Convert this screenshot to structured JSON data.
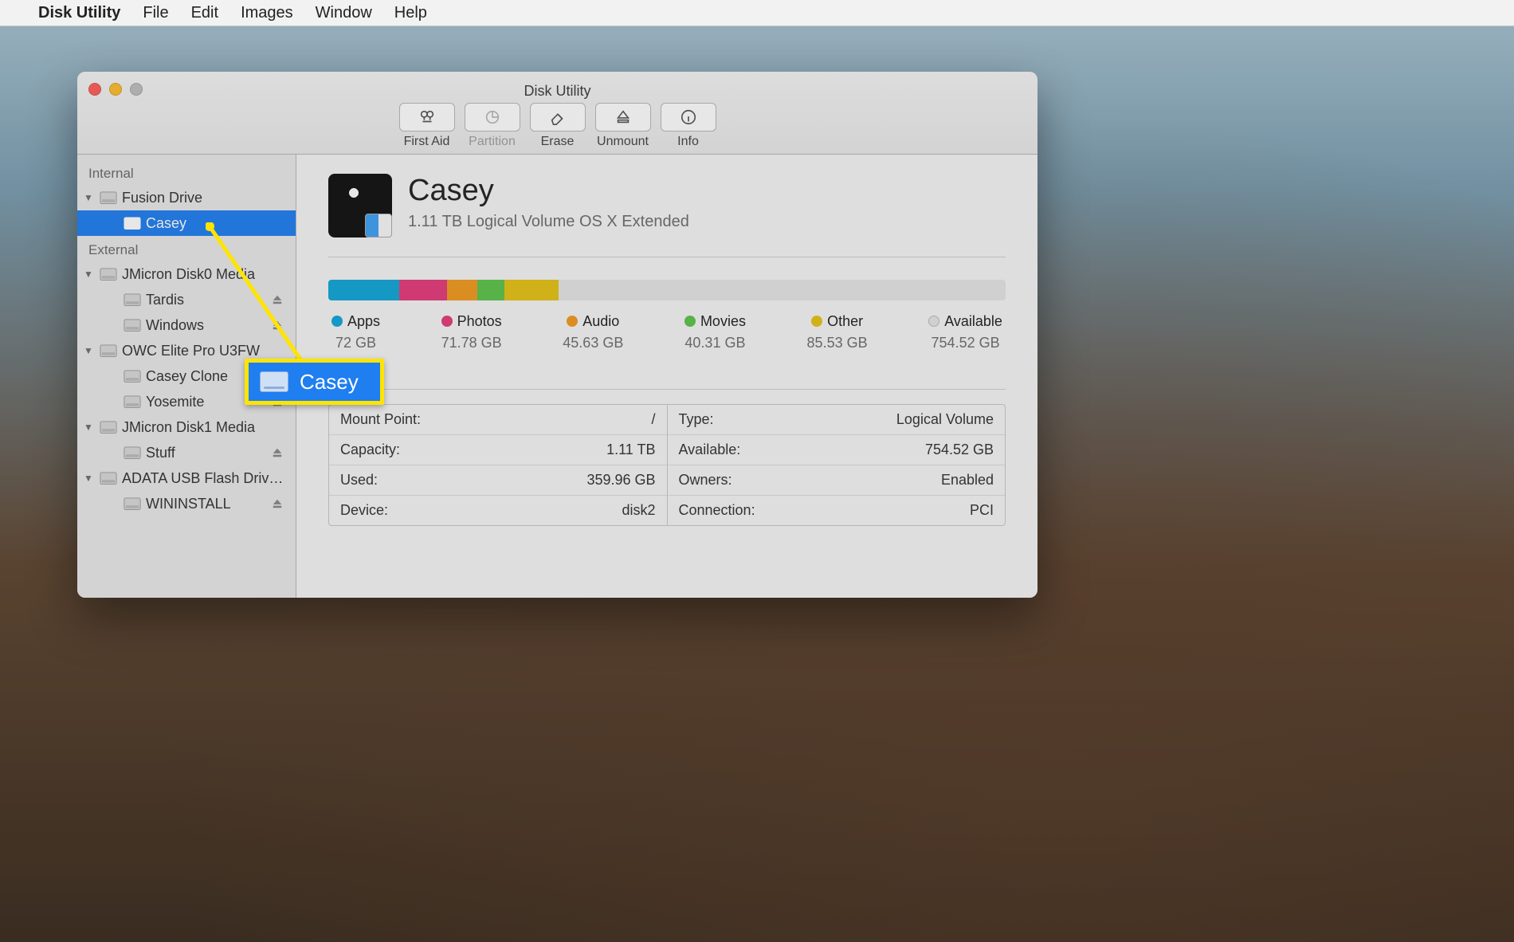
{
  "menubar": {
    "app": "Disk Utility",
    "items": [
      "File",
      "Edit",
      "Images",
      "Window",
      "Help"
    ]
  },
  "window": {
    "title": "Disk Utility",
    "toolbar": [
      {
        "id": "first-aid",
        "label": "First Aid",
        "enabled": true
      },
      {
        "id": "partition",
        "label": "Partition",
        "enabled": false
      },
      {
        "id": "erase",
        "label": "Erase",
        "enabled": true
      },
      {
        "id": "unmount",
        "label": "Unmount",
        "enabled": true
      },
      {
        "id": "info",
        "label": "Info",
        "enabled": true
      }
    ]
  },
  "sidebar": {
    "sections": [
      {
        "title": "Internal",
        "items": [
          {
            "name": "Fusion Drive",
            "level": 0,
            "disclosure": true,
            "eject": false
          },
          {
            "name": "Casey",
            "level": 1,
            "selected": true,
            "eject": false
          }
        ]
      },
      {
        "title": "External",
        "items": [
          {
            "name": "JMicron Disk0 Media",
            "level": 0,
            "disclosure": true,
            "eject": false
          },
          {
            "name": "Tardis",
            "level": 1,
            "eject": true
          },
          {
            "name": "Windows",
            "level": 1,
            "eject": true
          },
          {
            "name": "OWC Elite Pro U3FW",
            "level": 0,
            "disclosure": true,
            "eject": false
          },
          {
            "name": "Casey Clone",
            "level": 1,
            "eject": true
          },
          {
            "name": "Yosemite",
            "level": 1,
            "eject": true
          },
          {
            "name": "JMicron Disk1 Media",
            "level": 0,
            "disclosure": true,
            "eject": false
          },
          {
            "name": "Stuff",
            "level": 1,
            "eject": true
          },
          {
            "name": "ADATA USB Flash Driv…",
            "level": 0,
            "disclosure": true,
            "eject": false
          },
          {
            "name": "WININSTALL",
            "level": 1,
            "eject": true
          }
        ]
      }
    ]
  },
  "volume": {
    "name": "Casey",
    "subtitle": "1.11 TB Logical Volume OS X Extended",
    "usage": [
      {
        "label": "Apps",
        "size": "72 GB",
        "color": "#11a6d8",
        "width": 10.5
      },
      {
        "label": "Photos",
        "size": "71.78 GB",
        "color": "#e43b7a",
        "width": 7
      },
      {
        "label": "Audio",
        "size": "45.63 GB",
        "color": "#f19a1f",
        "width": 4.5
      },
      {
        "label": "Movies",
        "size": "40.31 GB",
        "color": "#5cc34a",
        "width": 4
      },
      {
        "label": "Other",
        "size": "85.53 GB",
        "color": "#e5c215",
        "width": 8
      },
      {
        "label": "Available",
        "size": "754.52 GB",
        "color": "#e5e5e5",
        "width": 66
      }
    ],
    "info_left": [
      {
        "k": "Mount Point:",
        "v": "/"
      },
      {
        "k": "Capacity:",
        "v": "1.11 TB"
      },
      {
        "k": "Used:",
        "v": "359.96 GB"
      },
      {
        "k": "Device:",
        "v": "disk2"
      }
    ],
    "info_right": [
      {
        "k": "Type:",
        "v": "Logical Volume"
      },
      {
        "k": "Available:",
        "v": "754.52 GB"
      },
      {
        "k": "Owners:",
        "v": "Enabled"
      },
      {
        "k": "Connection:",
        "v": "PCI"
      }
    ]
  },
  "callout": {
    "label": "Casey"
  }
}
